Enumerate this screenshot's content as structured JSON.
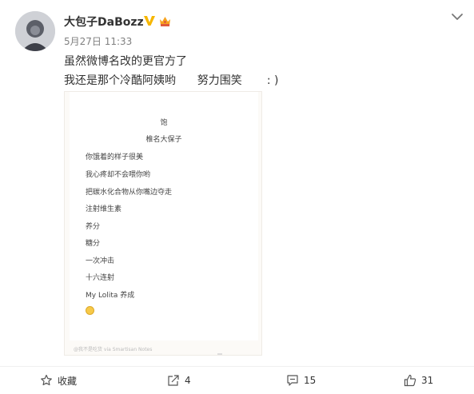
{
  "post": {
    "username": "大包子DaBozz",
    "time": "5月27日 11:33",
    "text_lines": [
      "虽然微博名改的更官方了",
      "我还是那个冷酷阿姨哟      努力围笑       : )"
    ]
  },
  "image": {
    "title": "饱",
    "subtitle": "椎名大保子",
    "lines": [
      "你饿着的样子很美",
      "我心疼却不会喂你哟",
      "把碳水化合物从你嘴边夺走",
      "注射维生素",
      "养分",
      "糖分",
      "一次冲击",
      "十六连射",
      "My Lolita 养成"
    ],
    "footer": "@我不是吃货 via Smartisan Notes"
  },
  "actions": {
    "collect_label": "收藏",
    "share_count": "4",
    "comment_count": "15",
    "like_count": "31"
  },
  "colors": {
    "accent": "#ff8200",
    "vip_badge": "#f6b600",
    "crown": "#f7a21d"
  }
}
